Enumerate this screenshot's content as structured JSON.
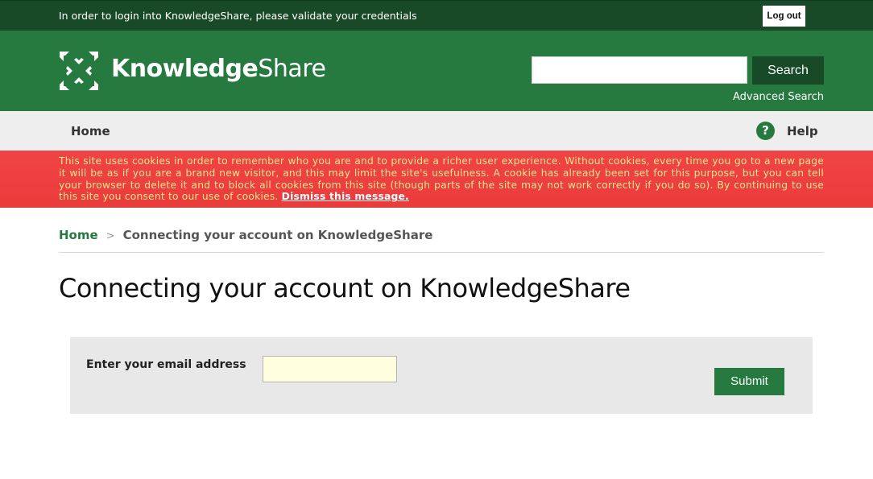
{
  "topbar": {
    "message": "In order to login into KnowledgeShare, please validate your credentials",
    "logout_label": "Log out"
  },
  "header": {
    "logo_bold": "Knowledge",
    "logo_light": "Share",
    "logo_icon": "arrows-logo-icon",
    "search_placeholder": "",
    "search_label": "Search",
    "advanced_search_label": "Advanced Search"
  },
  "nav": {
    "home_label": "Home",
    "help_icon_glyph": "?",
    "help_label": "Help"
  },
  "cookie_banner": {
    "text": "This site uses cookies in order to remember who you are and to provide a richer user experience. Without cookies, every time you go to a new page it will be as if you are a brand new visitor, and this may limit the site's usefulness. A cookie has already been set for this purpose, but you can tell your browser to delete it and to block all cookies from this site (though parts of the site may not work correctly if you do so). By continuing to use this site you consent to our use of cookies.",
    "dismiss_label": "Dismiss this message."
  },
  "breadcrumb": {
    "home_label": "Home",
    "separator": ">",
    "current_label": "Connecting your account on KnowledgeShare"
  },
  "page": {
    "title": "Connecting your account on KnowledgeShare"
  },
  "form": {
    "email_label": "Enter your email address",
    "email_value": "",
    "submit_label": "Submit"
  },
  "colors": {
    "topbar": "#184a27",
    "brand_green": "#267a3f",
    "cookie_red": "#ea3b3b",
    "cookie_text": "#f9e38b",
    "input_yellow": "#ffffe0"
  }
}
